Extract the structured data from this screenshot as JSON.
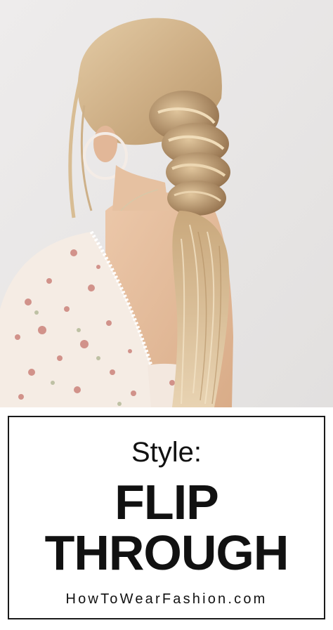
{
  "photo": {
    "subject": "woman-with-flip-through-braid-ponytail",
    "colors": {
      "background": "#e9e7e6",
      "hair_light": "#dcc39c",
      "hair_mid": "#c9a97c",
      "hair_dark": "#8a6a4a",
      "skin": "#e7c3a4",
      "blouse": "#f5ece4",
      "floral": "#c97c74"
    }
  },
  "caption": {
    "kicker": "Style:",
    "title_line1": "FLIP",
    "title_line2": "THROUGH",
    "website": "HowToWearFashion.com"
  }
}
